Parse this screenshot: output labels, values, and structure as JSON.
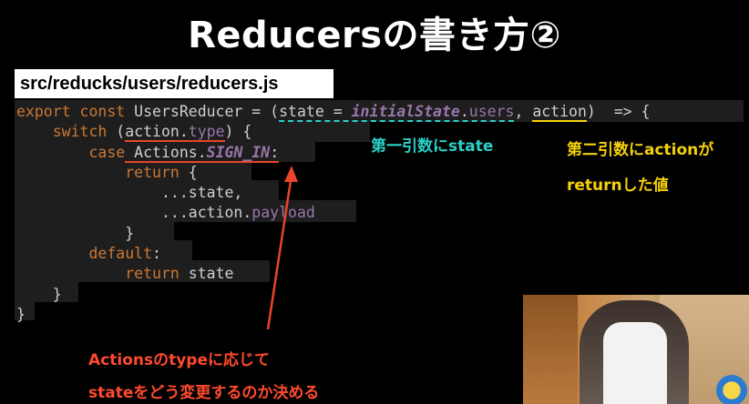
{
  "title": "Reducersの書き方②",
  "file_path": "src/reducks/users/reducers.js",
  "code": {
    "l1": {
      "kw1": "export",
      "kw2": "const",
      "name": "UsersReducer",
      "eq": " = (",
      "state_param": "state = ",
      "initial": "initialState",
      "dot": ".",
      "users": "users",
      "comma": ", ",
      "action": "action",
      "rest": ")  => {"
    },
    "l2": {
      "kw": "switch",
      "open": " (",
      "action": "action.",
      "type": "type",
      "close": ") {"
    },
    "l3": {
      "kw": "case",
      "actions": " Actions.",
      "sign_in": "SIGN_IN",
      "colon": ":"
    },
    "l4": {
      "kw": "return",
      "brace": " {"
    },
    "l5": {
      "text": "...state,"
    },
    "l6": {
      "text": "...action.",
      "payload": "payload"
    },
    "l7": {
      "text": "}"
    },
    "l8": {
      "kw": "default",
      "colon": ":"
    },
    "l9": {
      "kw": "return",
      "text": " state"
    },
    "l10": {
      "text": "}"
    },
    "l11": {
      "text": "}"
    }
  },
  "annotations": {
    "first_arg": "第一引数にstate",
    "second_arg_line1": "第二引数にactionが",
    "second_arg_line2": "returnした値",
    "actions_line1": "Actionsのtypeに応じて",
    "actions_line2": "stateをどう変更するのか決める"
  },
  "colors": {
    "keyword": "#cc7832",
    "constant": "#9876aa",
    "cyan_note": "#2ad0c8",
    "yellow_note": "#f5d10a",
    "red_note": "#ff4a2e"
  }
}
